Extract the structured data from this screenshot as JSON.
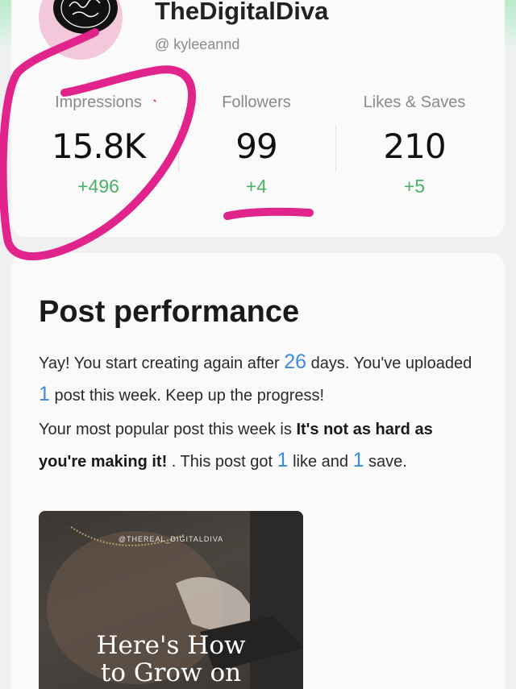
{
  "profile": {
    "name": "TheDigitalDiva",
    "handle": "@ kyleeannd"
  },
  "stats": [
    {
      "label": "Impressions",
      "value": "15.8K",
      "delta": "+496"
    },
    {
      "label": "Followers",
      "value": "99",
      "delta": "+4"
    },
    {
      "label": "Likes & Saves",
      "value": "210",
      "delta": "+5"
    }
  ],
  "performance": {
    "title": "Post performance",
    "p1_a": "Yay! You start creating again after ",
    "p1_days": "26",
    "p1_b": " days. You've uploaded ",
    "p1_posts": "1",
    "p1_c": " post this week. Keep up the progress!",
    "p2_a": "Your most popular post this week is ",
    "p2_post_title": "It's not as hard as you're making it!",
    "p2_b": " . This post got ",
    "p2_likes": "1",
    "p2_c": " like and ",
    "p2_saves": "1",
    "p2_d": " save."
  },
  "post": {
    "watermark": "@THEREAL_DIGITALDIVA",
    "headline_1": "Here's How",
    "headline_2": "to Grow on"
  },
  "colors": {
    "accent_blue": "#3d8be0",
    "delta_green": "#4caf6a",
    "annotation_pink": "#e0248c"
  }
}
